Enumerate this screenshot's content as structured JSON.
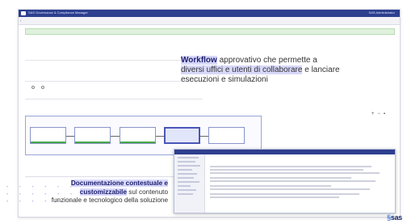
{
  "window": {
    "title": "SAS Governance & Compliance Manager",
    "right_text": "SAS Administrator"
  },
  "urlbar": {
    "url": "",
    "right_text": ""
  },
  "success_message": "",
  "fields": [
    {
      "label": "",
      "value": ""
    },
    {
      "label": "",
      "value": ""
    }
  ],
  "sections": {
    "first": "",
    "second": "",
    "radio_label": "",
    "radio_yes": "",
    "radio_no": "",
    "workflow": ""
  },
  "callout_workflow": {
    "bold": "Workflow",
    "part1": " approvativo che permette a ",
    "highlight1": "diversi uffici e utenti di collaborare",
    "part2": " e lanciare esecuzioni e simulazioni"
  },
  "workflow_nodes": [
    {
      "label": ""
    },
    {
      "label": ""
    },
    {
      "label": ""
    },
    {
      "label": ""
    },
    {
      "label": ""
    }
  ],
  "tabs_header": "",
  "tabs": [
    "",
    "",
    "",
    "",
    "",
    "",
    "",
    ""
  ],
  "subtab": "",
  "callout_docs": {
    "highlight": "Documentazione contestuale e customizzabile",
    "rest": " sul contenuto funzionale e tecnologico della soluzione"
  },
  "doc_panel": {
    "topbar": "",
    "title": "",
    "footer": ""
  },
  "brand": {
    "name": "sas"
  },
  "colors": {
    "titlebar": "#2d3f8f",
    "highlight": "#d8d8fb",
    "accent": "#1b1e6b"
  }
}
